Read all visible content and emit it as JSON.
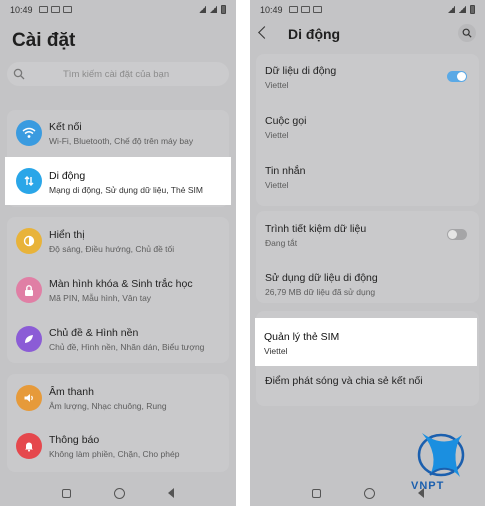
{
  "left": {
    "status": {
      "time": "10:49"
    },
    "title": "Cài đặt",
    "search": {
      "placeholder": "Tìm kiếm cài đặt của bạn"
    },
    "items": [
      {
        "title": "Kết nối",
        "subtitle": "Wi-Fi, Bluetooth, Chế độ trên máy bay",
        "icon": "wifi-icon",
        "color": "#3a9be0"
      },
      {
        "title": "Di động",
        "subtitle": "Mạng di động, Sử dụng dữ liệu, Thẻ SIM",
        "icon": "mobile-data-icon",
        "color": "#2aa6e8"
      },
      {
        "title": "Hiển thị",
        "subtitle": "Độ sáng, Điều hướng, Chủ đề tối",
        "icon": "display-icon",
        "color": "#e8b33a"
      },
      {
        "title": "Màn hình khóa & Sinh trắc học",
        "subtitle": "Mã PIN, Mẫu hình, Vân tay",
        "icon": "lock-icon",
        "color": "#e07fa5"
      },
      {
        "title": "Chủ đề & Hình nền",
        "subtitle": "Chủ đề, Hình nền, Nhãn dán, Biểu tượng",
        "icon": "theme-icon",
        "color": "#8b5cd6"
      },
      {
        "title": "Âm thanh",
        "subtitle": "Âm lượng, Nhạc chuông, Rung",
        "icon": "sound-icon",
        "color": "#e69a3a"
      },
      {
        "title": "Thông báo",
        "subtitle": "Không làm phiền, Chặn, Cho phép",
        "icon": "bell-icon",
        "color": "#e5484d"
      }
    ]
  },
  "right": {
    "status": {
      "time": "10:49"
    },
    "title": "Di động",
    "items": [
      {
        "title": "Dữ liệu di động",
        "subtitle": "Viettel",
        "toggle": true
      },
      {
        "title": "Cuộc gọi",
        "subtitle": "Viettel"
      },
      {
        "title": "Tin nhắn",
        "subtitle": "Viettel"
      },
      {
        "title": "Trình tiết kiệm dữ liệu",
        "subtitle": "Đang tắt",
        "toggle": false
      },
      {
        "title": "Sử dụng dữ liệu di động",
        "subtitle": "26,79 MB dữ liệu đã sử dụng"
      },
      {
        "title": "Quản lý thẻ SIM",
        "subtitle": "Viettel"
      },
      {
        "title": "Điểm phát sóng và chia sẻ kết nối",
        "subtitle": ""
      }
    ],
    "toggle_on_color": "#5aa9e6",
    "toggle_off_color": "#a5a5a7"
  },
  "watermark": {
    "text": "VNPT",
    "color": "#1b5fae"
  }
}
